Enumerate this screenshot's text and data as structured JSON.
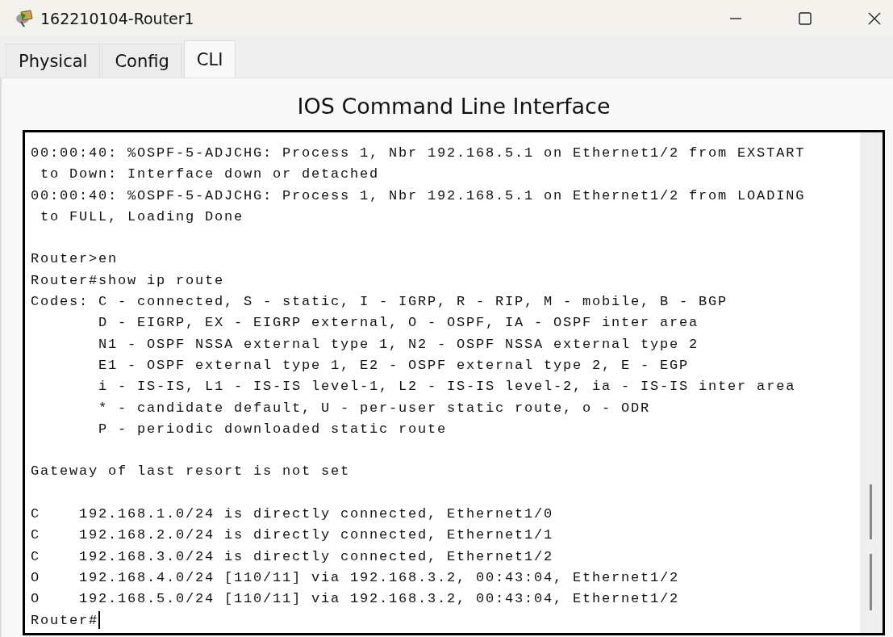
{
  "window": {
    "title": "162210104-Router1"
  },
  "tabs": [
    {
      "label": "Physical",
      "selected": false
    },
    {
      "label": "Config",
      "selected": false
    },
    {
      "label": "CLI",
      "selected": true
    }
  ],
  "heading": "IOS Command Line Interface",
  "terminal": {
    "blocks": [
      [
        "00:00:40: %OSPF-5-ADJCHG: Process 1, Nbr 192.168.5.1 on Ethernet1/2 from EXSTART",
        " to Down: Interface down or detached",
        "00:00:40: %OSPF-5-ADJCHG: Process 1, Nbr 192.168.5.1 on Ethernet1/2 from LOADING",
        " to FULL, Loading Done"
      ],
      [
        "Router>en",
        "Router#show ip route",
        "Codes: C - connected, S - static, I - IGRP, R - RIP, M - mobile, B - BGP",
        "       D - EIGRP, EX - EIGRP external, O - OSPF, IA - OSPF inter area",
        "       N1 - OSPF NSSA external type 1, N2 - OSPF NSSA external type 2",
        "       E1 - OSPF external type 1, E2 - OSPF external type 2, E - EGP",
        "       i - IS-IS, L1 - IS-IS level-1, L2 - IS-IS level-2, ia - IS-IS inter area",
        "       * - candidate default, U - per-user static route, o - ODR",
        "       P - periodic downloaded static route"
      ],
      [
        "Gateway of last resort is not set"
      ],
      [
        "C    192.168.1.0/24 is directly connected, Ethernet1/0",
        "C    192.168.2.0/24 is directly connected, Ethernet1/1",
        "C    192.168.3.0/24 is directly connected, Ethernet1/2",
        "O    192.168.4.0/24 [110/11] via 192.168.3.2, 00:43:04, Ethernet1/2",
        "O    192.168.5.0/24 [110/11] via 192.168.3.2, 00:43:04, Ethernet1/2"
      ]
    ],
    "prompt": "Router#"
  }
}
